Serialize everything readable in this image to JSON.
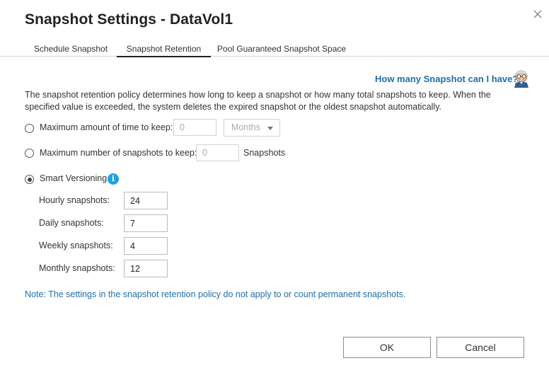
{
  "dialog": {
    "title": "Snapshot Settings - DataVol1"
  },
  "tabs": [
    {
      "label": "Schedule Snapshot",
      "active": false
    },
    {
      "label": "Snapshot Retention",
      "active": true
    },
    {
      "label": "Pool Guaranteed Snapshot Space",
      "active": false
    }
  ],
  "help": {
    "link_label": "How many Snapshot can I have?"
  },
  "description": "The snapshot retention policy determines how long to keep a snapshot or how many total snapshots to keep. When the specified value is exceeded, the system deletes the expired snapshot or the oldest snapshot automatically.",
  "options": {
    "max_time": {
      "label": "Maximum amount of time to keep:",
      "value": "0",
      "unit": "Months",
      "selected": false
    },
    "max_count": {
      "label": "Maximum number of snapshots to keep:",
      "value": "0",
      "suffix": "Snapshots",
      "selected": false
    },
    "smart_versioning": {
      "label": "Smart Versioning",
      "selected": true,
      "info_icon_glyph": "i",
      "fields": [
        {
          "label": "Hourly snapshots:",
          "value": "24"
        },
        {
          "label": "Daily snapshots:",
          "value": "7"
        },
        {
          "label": "Weekly snapshots:",
          "value": "4"
        },
        {
          "label": "Monthly snapshots:",
          "value": "12"
        }
      ]
    }
  },
  "note": "Note: The settings in the snapshot retention policy do not apply to or count permanent snapshots.",
  "buttons": {
    "ok": "OK",
    "cancel": "Cancel"
  },
  "colors": {
    "link": "#1f6fa8",
    "info_icon": "#1fa3e0",
    "title": "#222222"
  },
  "icons": {
    "close": "close-icon",
    "mascot": "assistant-mascot-icon",
    "info": "info-icon",
    "dropdown": "chevron-down-icon"
  }
}
